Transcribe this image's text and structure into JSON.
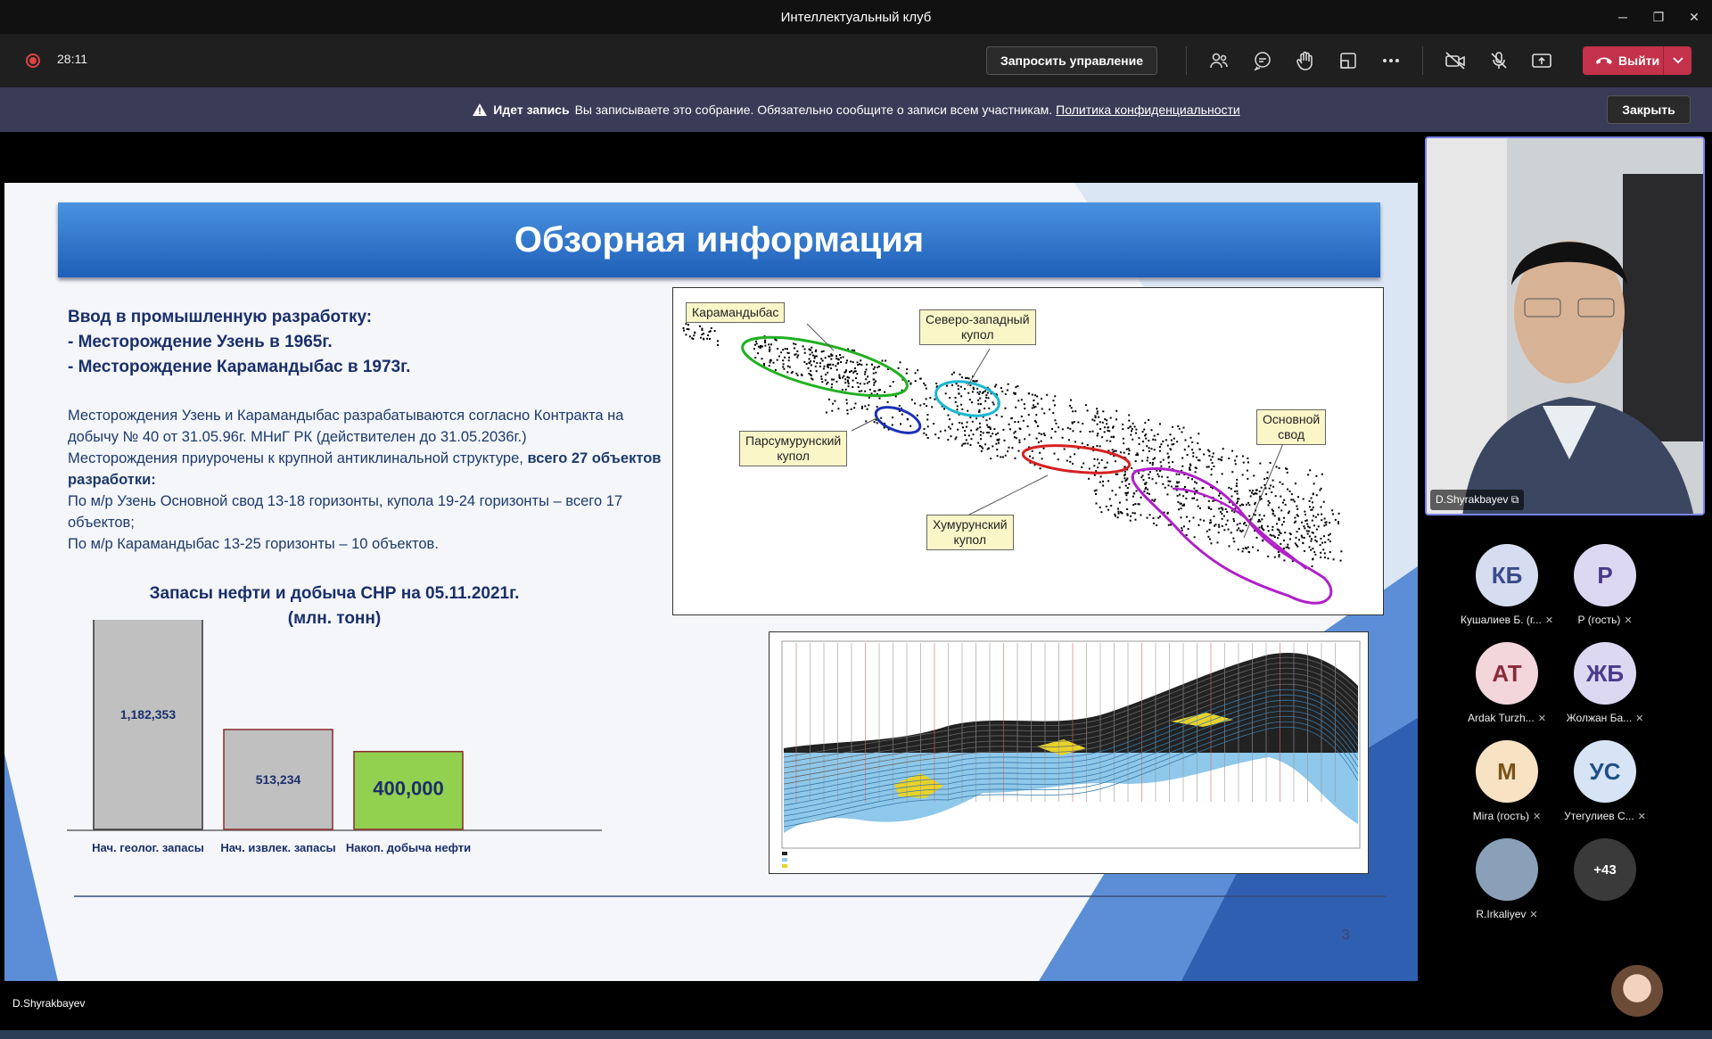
{
  "window": {
    "title": "Интеллектуальный клуб",
    "controls": [
      "minimize-icon",
      "restore-icon",
      "close-icon"
    ]
  },
  "toolbar": {
    "timer": "28:11",
    "request_control": "Запросить управление",
    "leave": "Выйти",
    "icons": [
      "people-icon",
      "chat-icon",
      "reactions-icon",
      "rooms-icon",
      "more-icon",
      "camera-off-icon",
      "mic-off-icon",
      "share-icon"
    ]
  },
  "banner": {
    "bold": "Идет запись",
    "text": "Вы записываете это собрание. Обязательно сообщите о записи всем участникам.",
    "link": "Политика конфиденциальности",
    "close": "Закрыть"
  },
  "slide": {
    "title": "Обзорная информация",
    "intro": [
      "Ввод в промышленную разработку:",
      "- Месторождение Узень в 1965г.",
      "- Месторождение Карамандыбас в 1973г."
    ],
    "para1": "Месторождения Узень и Карамандыбас разрабатываются согласно Контракта на добычу № 40 от 31.05.96г. МНиГ РК (действителен до 31.05.2036г.)",
    "para2a": "Месторождения приурочены к крупной антиклинальной структуре, ",
    "para2b": "всего 27 объектов разработки:",
    "para3": "По м/р Узень Основной свод 13-18 горизонты, купола 19-24 горизонты – всего 17 объектов;",
    "para4": "По м/р Карамандыбас 13-25 горизонты – 10 объектов.",
    "chart_title_1": "Запасы нефти и добыча СНР на 05.11.2021г.",
    "chart_title_2": "(млн. тонн)",
    "map_labels": {
      "karamandybas": "Карамандыбас",
      "nw_dome_1": "Северо-западный",
      "nw_dome_2": "купол",
      "parsumurun_1": "Парсумурунский",
      "parsumurun_2": "купол",
      "khumurun_1": "Хумурунский",
      "khumurun_2": "купол",
      "main_1": "Основной",
      "main_2": "свод"
    },
    "page_number": "3"
  },
  "chart_data": {
    "type": "bar",
    "title": "Запасы нефти и добыча СНР на 05.11.2021г. (млн. тонн)",
    "categories": [
      "Нач. геолог. запасы",
      "Нач. извлек. запасы",
      "Накоп. добыча нефти"
    ],
    "values": [
      1182353,
      513234,
      400000
    ],
    "value_labels": [
      "1,182,353",
      "513,234",
      "400,000"
    ],
    "colors": [
      "#c0c0c0",
      "#c0c0c0",
      "#92d050"
    ],
    "ylim": [
      0,
      1182353
    ]
  },
  "presenter_label": "D.Shyrakbayev",
  "video": {
    "name": "D.Shyrakbayev"
  },
  "participants": [
    {
      "initials": "КБ",
      "name": "Кушалиев Б. (г...",
      "bg": "#d6ddf0",
      "fg": "#3b4a8a"
    },
    {
      "initials": "Р",
      "name": "Р (гость)",
      "bg": "#ddd8f2",
      "fg": "#4b3a8a"
    },
    {
      "initials": "АТ",
      "name": "Ardak Turzh...",
      "bg": "#f2d6dc",
      "fg": "#8a2a3b"
    },
    {
      "initials": "ЖБ",
      "name": "Жолжан Ба...",
      "bg": "#ddd8f2",
      "fg": "#4b3a8a"
    },
    {
      "initials": "М",
      "name": "Mira (гость)",
      "bg": "#f7e3c4",
      "fg": "#7a5217"
    },
    {
      "initials": "УС",
      "name": "Утегулиев С...",
      "bg": "#d6e4f6",
      "fg": "#1f4f86"
    },
    {
      "initials": "",
      "name": "R.Irkaliyev",
      "bg": "#8aa0b8",
      "fg": "#fff"
    },
    {
      "initials": "+43",
      "name": "",
      "bg": "#3a3a3a",
      "fg": "#fff"
    }
  ]
}
